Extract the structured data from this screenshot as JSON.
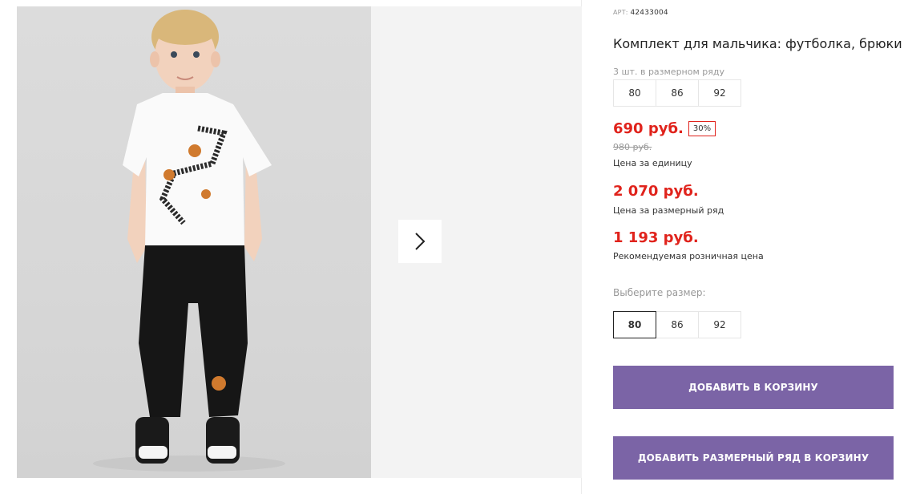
{
  "gallery": {
    "image_alt": "product-photo-boy-in-tshirt-and-pants"
  },
  "product": {
    "art_label": "АРТ:",
    "art_value": "42433004",
    "title": "Комплект для мальчика: футболка, брюки",
    "row_note": "3 шт. в размерном ряду",
    "row_sizes": [
      "80",
      "86",
      "92"
    ],
    "price": "690 руб.",
    "discount": "30%",
    "old_price": "980 руб.",
    "unit_caption": "Цена за единицу",
    "set_price": "2 070 руб.",
    "set_caption": "Цена за размерный ряд",
    "rrp_price": "1 193 руб.",
    "rrp_caption": "Рекомендуемая розничная цена",
    "choose_label": "Выберите размер:",
    "select_sizes": [
      "80",
      "86",
      "92"
    ],
    "selected_size": "80",
    "add_to_cart": "ДОБАВИТЬ В КОРЗИНУ",
    "add_row_to_cart": "ДОБАВИТЬ РАЗМЕРНЫЙ РЯД В КОРЗИНУ"
  },
  "colors": {
    "accent": "#7b64a6",
    "price_red": "#e0231c"
  },
  "icons": {
    "next": "chevron-right-icon"
  }
}
